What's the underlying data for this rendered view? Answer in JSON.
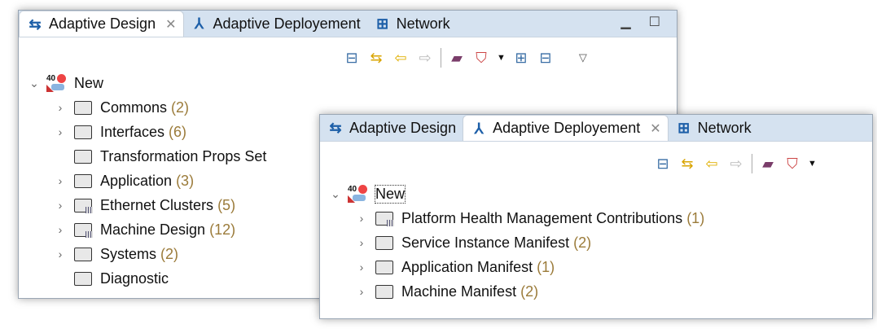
{
  "window1": {
    "tabs": [
      {
        "label": "Adaptive Design",
        "active": true
      },
      {
        "label": "Adaptive Deployement"
      },
      {
        "label": "Network"
      }
    ],
    "window_buttons": [
      "minimize",
      "maximize"
    ],
    "tree": {
      "root": "New",
      "items": [
        {
          "label": "Commons",
          "count": "(2)",
          "expandable": true
        },
        {
          "label": "Interfaces",
          "count": "(6)",
          "expandable": true
        },
        {
          "label": "Transformation Props Set",
          "count": "",
          "expandable": false
        },
        {
          "label": "Application",
          "count": "(3)",
          "expandable": true
        },
        {
          "label": "Ethernet Clusters",
          "count": "(5)",
          "expandable": true,
          "grid": true
        },
        {
          "label": "Machine Design",
          "count": "(12)",
          "expandable": true,
          "grid": true
        },
        {
          "label": "Systems",
          "count": "(2)",
          "expandable": true
        },
        {
          "label": "Diagnostic",
          "count": "",
          "expandable": false
        }
      ]
    }
  },
  "window2": {
    "tabs": [
      {
        "label": "Adaptive Design"
      },
      {
        "label": "Adaptive Deployement",
        "active": true
      },
      {
        "label": "Network"
      }
    ],
    "tree": {
      "root": "New",
      "items": [
        {
          "label": "Platform Health Management Contributions",
          "count": "(1)",
          "grid": true
        },
        {
          "label": "Service Instance Manifest",
          "count": "(2)"
        },
        {
          "label": "Application Manifest",
          "count": "(1)"
        },
        {
          "label": "Machine Manifest",
          "count": "(2)"
        }
      ]
    }
  },
  "icons": {
    "close": "✕",
    "chevron_down": "⌄",
    "chevron_right": "›"
  }
}
